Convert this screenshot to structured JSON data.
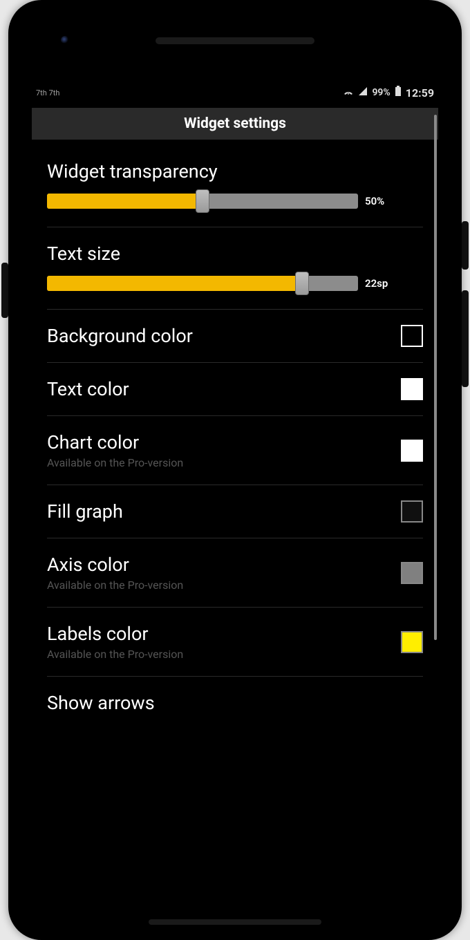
{
  "status": {
    "left_text": "7th 7th",
    "battery": "99%",
    "time": "12:59",
    "wifi_icon": "wifi",
    "signal_icon": "signal",
    "battery_icon": "battery"
  },
  "header": {
    "title": "Widget settings"
  },
  "sliders": {
    "transparency": {
      "label": "Widget transparency",
      "value_text": "50%",
      "percent": 50
    },
    "textsize": {
      "label": "Text size",
      "value_text": "22sp",
      "percent": 82
    }
  },
  "rows": {
    "background_color": {
      "label": "Background color",
      "subtitle": "",
      "swatch_color": "#000000",
      "swatch_border": "#ffffff"
    },
    "text_color": {
      "label": "Text color",
      "subtitle": "",
      "swatch_color": "#ffffff",
      "swatch_border": "#ffffff"
    },
    "chart_color": {
      "label": "Chart color",
      "subtitle": "Available on the Pro-version",
      "swatch_color": "#ffffff",
      "swatch_border": "#ffffff"
    },
    "fill_graph": {
      "label": "Fill graph",
      "subtitle": "",
      "swatch_color": "#101010",
      "swatch_border": "#888888"
    },
    "axis_color": {
      "label": "Axis color",
      "subtitle": "Available on the Pro-version",
      "swatch_color": "#808080",
      "swatch_border": "#888888"
    },
    "labels_color": {
      "label": "Labels color",
      "subtitle": "Available on the Pro-version",
      "swatch_color": "#ffee00",
      "swatch_border": "#888888"
    },
    "show_arrows": {
      "label": "Show arrows",
      "subtitle": ""
    }
  }
}
